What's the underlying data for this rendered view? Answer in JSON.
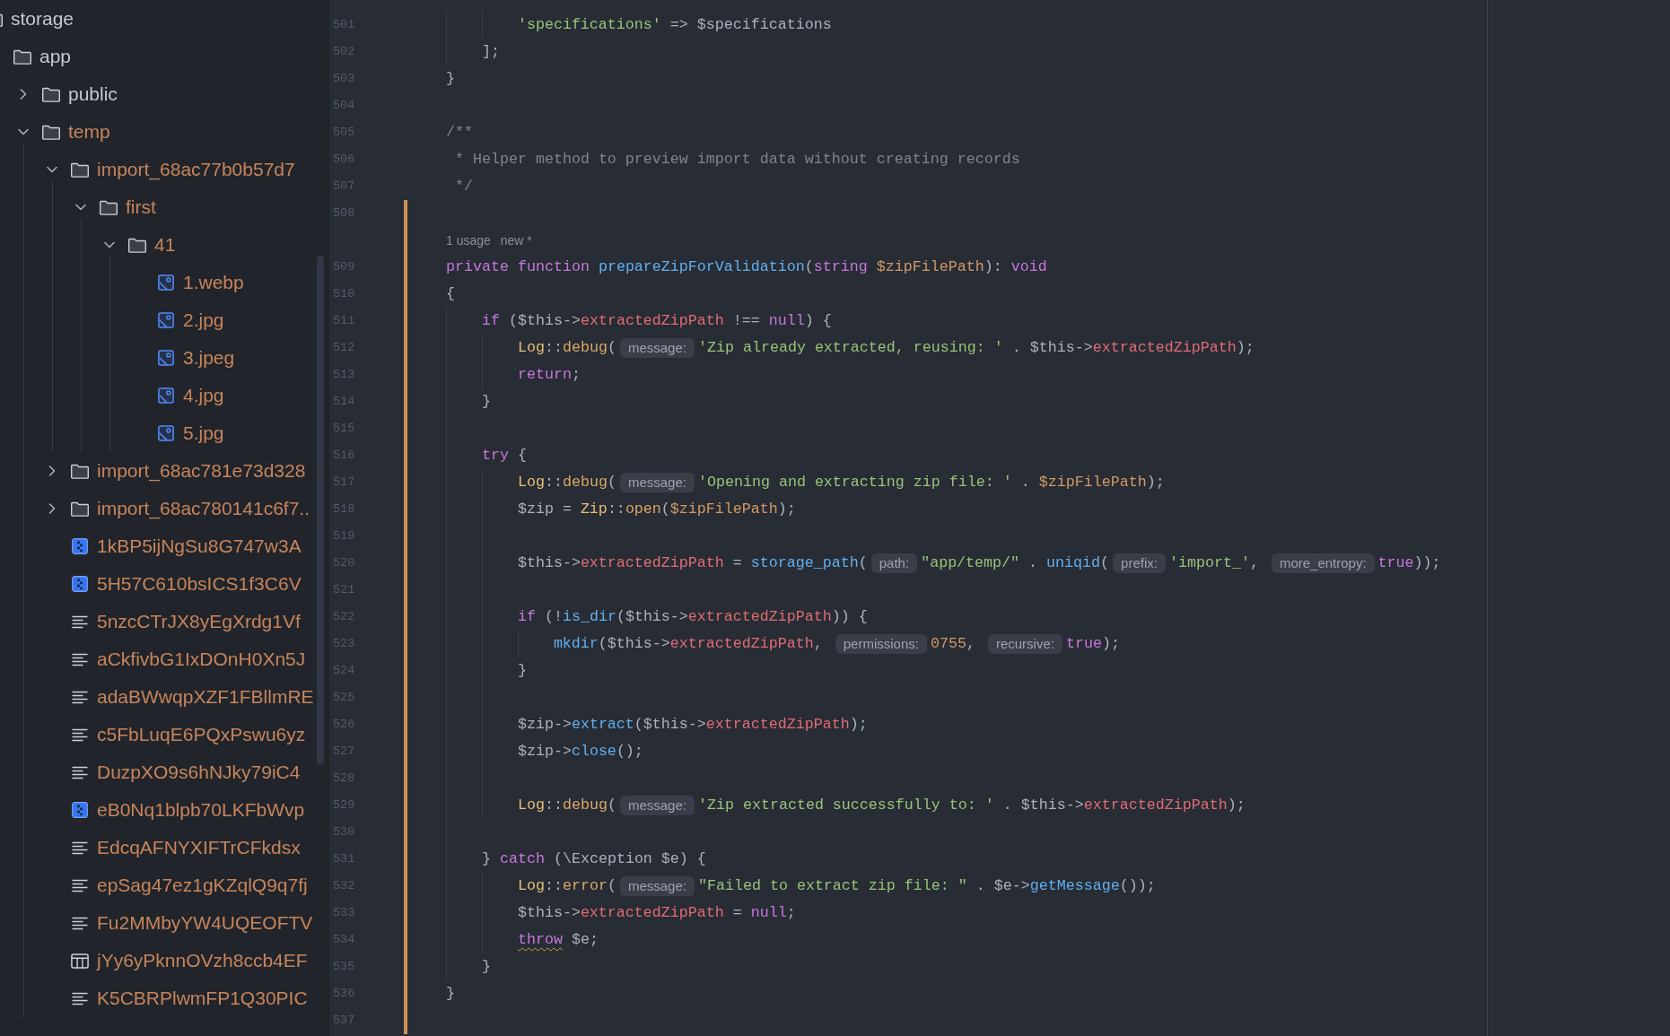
{
  "project_tree": {
    "items": [
      {
        "kind": "folder",
        "label": "storage",
        "ignored": false,
        "children": [
          {
            "kind": "folder",
            "label": "app",
            "ignored": false,
            "children": [
              {
                "kind": "folder",
                "label": "public",
                "expanded": false,
                "ignored": false
              },
              {
                "kind": "folder",
                "label": "temp",
                "expanded": true,
                "ignored": true,
                "children": [
                  {
                    "kind": "folder",
                    "label": "import_68ac77b0b57d7",
                    "expanded": true,
                    "ignored": true,
                    "children": [
                      {
                        "kind": "folder",
                        "label": "first",
                        "expanded": true,
                        "ignored": true,
                        "children": [
                          {
                            "kind": "folder",
                            "label": "41",
                            "expanded": true,
                            "ignored": true,
                            "children": [
                              {
                                "kind": "image",
                                "label": "1.webp",
                                "ignored": true
                              },
                              {
                                "kind": "image",
                                "label": "2.jpg",
                                "ignored": true
                              },
                              {
                                "kind": "image",
                                "label": "3.jpeg",
                                "ignored": true
                              },
                              {
                                "kind": "image",
                                "label": "4.jpg",
                                "ignored": true
                              },
                              {
                                "kind": "image",
                                "label": "5.jpg",
                                "ignored": true
                              }
                            ]
                          }
                        ]
                      }
                    ]
                  },
                  {
                    "kind": "folder",
                    "label": "import_68ac781e73d328",
                    "expanded": false,
                    "ignored": true
                  },
                  {
                    "kind": "folder",
                    "label": "import_68ac780141c6f7..",
                    "expanded": false,
                    "ignored": true
                  },
                  {
                    "kind": "archive",
                    "label": "1kBP5ijNgSu8G747w3A",
                    "ignored": true
                  },
                  {
                    "kind": "archive",
                    "label": "5H57C610bsICS1f3C6V",
                    "ignored": true
                  },
                  {
                    "kind": "text",
                    "label": "5nzcCTrJX8yEgXrdg1Vf",
                    "ignored": true
                  },
                  {
                    "kind": "text",
                    "label": "aCkfivbG1IxDOnH0Xn5J",
                    "ignored": true
                  },
                  {
                    "kind": "text",
                    "label": "adaBWwqpXZF1FBllmRE",
                    "ignored": true
                  },
                  {
                    "kind": "text",
                    "label": "c5FbLuqE6PQxPswu6yz",
                    "ignored": true
                  },
                  {
                    "kind": "text",
                    "label": "DuzpXO9s6hNJky79iC4",
                    "ignored": true
                  },
                  {
                    "kind": "archive",
                    "label": "eB0Nq1blpb70LKFbWvp",
                    "ignored": true
                  },
                  {
                    "kind": "text",
                    "label": "EdcqAFNYXIFTrCFkdsx",
                    "ignored": true
                  },
                  {
                    "kind": "text",
                    "label": "epSag47ez1gKZqlQ9q7fj",
                    "ignored": true
                  },
                  {
                    "kind": "text",
                    "label": "Fu2MMbyYW4UQEOFTV",
                    "ignored": true
                  },
                  {
                    "kind": "table",
                    "label": "jYy6yPknnOVzh8ccb4EF",
                    "ignored": true
                  },
                  {
                    "kind": "text",
                    "label": "K5CBRPlwmFP1Q30PIC",
                    "ignored": true
                  }
                ]
              }
            ]
          }
        ]
      }
    ]
  },
  "editor": {
    "lines": [
      {
        "number": "501",
        "changed": false,
        "segments": [
          {
            "kind": "code",
            "tokens": [
              {
                "kind": "string",
                "text": "            'specifications'"
              },
              {
                "kind": "plain",
                "text": " => $specifications"
              }
            ]
          }
        ]
      },
      {
        "number": "502",
        "changed": false,
        "segments": [
          {
            "kind": "code",
            "tokens": [
              {
                "kind": "plain",
                "text": "        ];"
              }
            ]
          }
        ]
      },
      {
        "number": "503",
        "changed": false,
        "segments": [
          {
            "kind": "code",
            "tokens": [
              {
                "kind": "plain",
                "text": "    }"
              }
            ]
          }
        ]
      },
      {
        "number": "504",
        "changed": false
      },
      {
        "number": "505",
        "changed": false,
        "segments": [
          {
            "kind": "code",
            "tokens": [
              {
                "kind": "comment",
                "text": "    /**"
              }
            ]
          }
        ]
      },
      {
        "number": "506",
        "changed": false,
        "segments": [
          {
            "kind": "code",
            "tokens": [
              {
                "kind": "comment",
                "text": "     * Helper method to preview import data without creating records"
              }
            ]
          }
        ]
      },
      {
        "number": "507",
        "changed": false,
        "segments": [
          {
            "kind": "code",
            "tokens": [
              {
                "kind": "comment",
                "text": "     */"
              }
            ]
          }
        ]
      },
      {
        "number": "508",
        "changed": true
      },
      {
        "number": "509",
        "changed": true,
        "usage_hint": {
          "usages": "1 usage",
          "author": "new *"
        },
        "segments": [
          {
            "kind": "code",
            "tokens": [
              {
                "kind": "keyword",
                "text": "    private function "
              },
              {
                "kind": "function",
                "text": "prepareZipForValidation"
              },
              {
                "kind": "plain",
                "text": "("
              },
              {
                "kind": "keyword",
                "text": "string "
              },
              {
                "kind": "param",
                "text": "$zipFilePath"
              },
              {
                "kind": "plain",
                "text": "): "
              },
              {
                "kind": "keyword",
                "text": "void"
              }
            ]
          }
        ]
      },
      {
        "number": "510",
        "changed": true,
        "segments": [
          {
            "kind": "code",
            "tokens": [
              {
                "kind": "plain",
                "text": "    {"
              }
            ]
          }
        ]
      },
      {
        "number": "511",
        "changed": true,
        "segments": [
          {
            "kind": "code",
            "tokens": [
              {
                "kind": "keyword",
                "text": "        if"
              },
              {
                "kind": "plain",
                "text": " ($this->"
              },
              {
                "kind": "property",
                "text": "extractedZipPath"
              },
              {
                "kind": "plain",
                "text": " !== "
              },
              {
                "kind": "keyword",
                "text": "null"
              },
              {
                "kind": "plain",
                "text": ") {"
              }
            ]
          }
        ]
      },
      {
        "number": "512",
        "changed": true,
        "segments": [
          {
            "kind": "code",
            "tokens": [
              {
                "kind": "class",
                "text": "            Log"
              },
              {
                "kind": "plain",
                "text": "::"
              },
              {
                "kind": "static",
                "text": "debug"
              },
              {
                "kind": "plain",
                "text": "("
              }
            ]
          },
          {
            "kind": "hint",
            "text": "message:"
          },
          {
            "kind": "code",
            "tokens": [
              {
                "kind": "string",
                "text": "'Zip already extracted, reusing: '"
              },
              {
                "kind": "plain",
                "text": " . $this->"
              },
              {
                "kind": "property",
                "text": "extractedZipPath"
              },
              {
                "kind": "plain",
                "text": ");"
              }
            ]
          }
        ]
      },
      {
        "number": "513",
        "changed": true,
        "segments": [
          {
            "kind": "code",
            "tokens": [
              {
                "kind": "keyword",
                "text": "            return"
              },
              {
                "kind": "plain",
                "text": ";"
              }
            ]
          }
        ]
      },
      {
        "number": "514",
        "changed": true,
        "segments": [
          {
            "kind": "code",
            "tokens": [
              {
                "kind": "plain",
                "text": "        }"
              }
            ]
          }
        ]
      },
      {
        "number": "515",
        "changed": true
      },
      {
        "number": "516",
        "changed": true,
        "segments": [
          {
            "kind": "code",
            "tokens": [
              {
                "kind": "keyword",
                "text": "        try"
              },
              {
                "kind": "plain",
                "text": " {"
              }
            ]
          }
        ]
      },
      {
        "number": "517",
        "changed": true,
        "segments": [
          {
            "kind": "code",
            "tokens": [
              {
                "kind": "class",
                "text": "            Log"
              },
              {
                "kind": "plain",
                "text": "::"
              },
              {
                "kind": "static",
                "text": "debug"
              },
              {
                "kind": "plain",
                "text": "("
              }
            ]
          },
          {
            "kind": "hint",
            "text": "message:"
          },
          {
            "kind": "code",
            "tokens": [
              {
                "kind": "string",
                "text": "'Opening and extracting zip file: '"
              },
              {
                "kind": "plain",
                "text": " . "
              },
              {
                "kind": "param",
                "text": "$zipFilePath"
              },
              {
                "kind": "plain",
                "text": ");"
              }
            ]
          }
        ]
      },
      {
        "number": "518",
        "changed": true,
        "segments": [
          {
            "kind": "code",
            "tokens": [
              {
                "kind": "plain",
                "text": "            $zip = "
              },
              {
                "kind": "class",
                "text": "Zip"
              },
              {
                "kind": "plain",
                "text": "::"
              },
              {
                "kind": "static",
                "text": "open"
              },
              {
                "kind": "plain",
                "text": "("
              },
              {
                "kind": "param",
                "text": "$zipFilePath"
              },
              {
                "kind": "plain",
                "text": ");"
              }
            ]
          }
        ]
      },
      {
        "number": "519",
        "changed": true
      },
      {
        "number": "520",
        "changed": true,
        "segments": [
          {
            "kind": "code",
            "tokens": [
              {
                "kind": "plain",
                "text": "            $this->"
              },
              {
                "kind": "property",
                "text": "extractedZipPath"
              },
              {
                "kind": "plain",
                "text": " = "
              },
              {
                "kind": "function",
                "text": "storage_path"
              },
              {
                "kind": "plain",
                "text": "("
              }
            ]
          },
          {
            "kind": "hint",
            "text": "path:"
          },
          {
            "kind": "code",
            "tokens": [
              {
                "kind": "string",
                "text": "\"app/temp/\""
              },
              {
                "kind": "plain",
                "text": " . "
              },
              {
                "kind": "function",
                "text": "uniqid"
              },
              {
                "kind": "plain",
                "text": "("
              }
            ]
          },
          {
            "kind": "hint",
            "text": "prefix:"
          },
          {
            "kind": "code",
            "tokens": [
              {
                "kind": "string",
                "text": "'import_'"
              },
              {
                "kind": "plain",
                "text": ", "
              }
            ]
          },
          {
            "kind": "hint",
            "text": "more_entropy:"
          },
          {
            "kind": "code",
            "tokens": [
              {
                "kind": "keyword",
                "text": "true"
              },
              {
                "kind": "plain",
                "text": "));"
              }
            ]
          }
        ]
      },
      {
        "number": "521",
        "changed": true
      },
      {
        "number": "522",
        "changed": true,
        "segments": [
          {
            "kind": "code",
            "tokens": [
              {
                "kind": "keyword",
                "text": "            if"
              },
              {
                "kind": "plain",
                "text": " (!"
              },
              {
                "kind": "function",
                "text": "is_dir"
              },
              {
                "kind": "plain",
                "text": "($this->"
              },
              {
                "kind": "property",
                "text": "extractedZipPath"
              },
              {
                "kind": "plain",
                "text": ")) {"
              }
            ]
          }
        ]
      },
      {
        "number": "523",
        "changed": true,
        "segments": [
          {
            "kind": "code",
            "tokens": [
              {
                "kind": "function",
                "text": "                mkdir"
              },
              {
                "kind": "plain",
                "text": "($this->"
              },
              {
                "kind": "property",
                "text": "extractedZipPath"
              },
              {
                "kind": "plain",
                "text": ", "
              }
            ]
          },
          {
            "kind": "hint",
            "text": "permissions:"
          },
          {
            "kind": "code",
            "tokens": [
              {
                "kind": "number",
                "text": "0755"
              },
              {
                "kind": "plain",
                "text": ", "
              }
            ]
          },
          {
            "kind": "hint",
            "text": "recursive:"
          },
          {
            "kind": "code",
            "tokens": [
              {
                "kind": "keyword",
                "text": "true"
              },
              {
                "kind": "plain",
                "text": ");"
              }
            ]
          }
        ]
      },
      {
        "number": "524",
        "changed": true,
        "segments": [
          {
            "kind": "code",
            "tokens": [
              {
                "kind": "plain",
                "text": "            }"
              }
            ]
          }
        ]
      },
      {
        "number": "525",
        "changed": true
      },
      {
        "number": "526",
        "changed": true,
        "segments": [
          {
            "kind": "code",
            "tokens": [
              {
                "kind": "plain",
                "text": "            $zip->"
              },
              {
                "kind": "function",
                "text": "extract"
              },
              {
                "kind": "plain",
                "text": "($this->"
              },
              {
                "kind": "property",
                "text": "extractedZipPath"
              },
              {
                "kind": "plain",
                "text": ");"
              }
            ]
          }
        ]
      },
      {
        "number": "527",
        "changed": true,
        "segments": [
          {
            "kind": "code",
            "tokens": [
              {
                "kind": "plain",
                "text": "            $zip->"
              },
              {
                "kind": "function",
                "text": "close"
              },
              {
                "kind": "plain",
                "text": "();"
              }
            ]
          }
        ]
      },
      {
        "number": "528",
        "changed": true
      },
      {
        "number": "529",
        "changed": true,
        "segments": [
          {
            "kind": "code",
            "tokens": [
              {
                "kind": "class",
                "text": "            Log"
              },
              {
                "kind": "plain",
                "text": "::"
              },
              {
                "kind": "static",
                "text": "debug"
              },
              {
                "kind": "plain",
                "text": "("
              }
            ]
          },
          {
            "kind": "hint",
            "text": "message:"
          },
          {
            "kind": "code",
            "tokens": [
              {
                "kind": "string",
                "text": "'Zip extracted successfully to: '"
              },
              {
                "kind": "plain",
                "text": " . $this->"
              },
              {
                "kind": "property",
                "text": "extractedZipPath"
              },
              {
                "kind": "plain",
                "text": ");"
              }
            ]
          }
        ]
      },
      {
        "number": "530",
        "changed": true
      },
      {
        "number": "531",
        "changed": true,
        "segments": [
          {
            "kind": "code",
            "tokens": [
              {
                "kind": "plain",
                "text": "        } "
              },
              {
                "kind": "keyword",
                "text": "catch"
              },
              {
                "kind": "plain",
                "text": " (\\Exception $e) {"
              }
            ]
          }
        ]
      },
      {
        "number": "532",
        "changed": true,
        "segments": [
          {
            "kind": "code",
            "tokens": [
              {
                "kind": "class",
                "text": "            Log"
              },
              {
                "kind": "plain",
                "text": "::"
              },
              {
                "kind": "static",
                "text": "error"
              },
              {
                "kind": "plain",
                "text": "("
              }
            ]
          },
          {
            "kind": "hint",
            "text": "message:"
          },
          {
            "kind": "code",
            "tokens": [
              {
                "kind": "string",
                "text": "\"Failed to extract zip file: \""
              },
              {
                "kind": "plain",
                "text": " . $e->"
              },
              {
                "kind": "function",
                "text": "getMessage"
              },
              {
                "kind": "plain",
                "text": "());"
              }
            ]
          }
        ]
      },
      {
        "number": "533",
        "changed": true,
        "segments": [
          {
            "kind": "code",
            "tokens": [
              {
                "kind": "plain",
                "text": "            $this->"
              },
              {
                "kind": "property",
                "text": "extractedZipPath"
              },
              {
                "kind": "plain",
                "text": " = "
              },
              {
                "kind": "keyword",
                "text": "null"
              },
              {
                "kind": "plain",
                "text": ";"
              }
            ]
          }
        ]
      },
      {
        "number": "534",
        "changed": true,
        "segments": [
          {
            "kind": "code",
            "tokens": [
              {
                "kind": "keyword",
                "text": "            throw",
                "warning": true
              },
              {
                "kind": "plain",
                "text": " $e;"
              }
            ]
          }
        ]
      },
      {
        "number": "535",
        "changed": true,
        "segments": [
          {
            "kind": "code",
            "tokens": [
              {
                "kind": "plain",
                "text": "        }"
              }
            ]
          }
        ]
      },
      {
        "number": "536",
        "changed": true,
        "segments": [
          {
            "kind": "code",
            "tokens": [
              {
                "kind": "plain",
                "text": "    }"
              }
            ]
          }
        ]
      },
      {
        "number": "537",
        "changed": true
      }
    ]
  }
}
